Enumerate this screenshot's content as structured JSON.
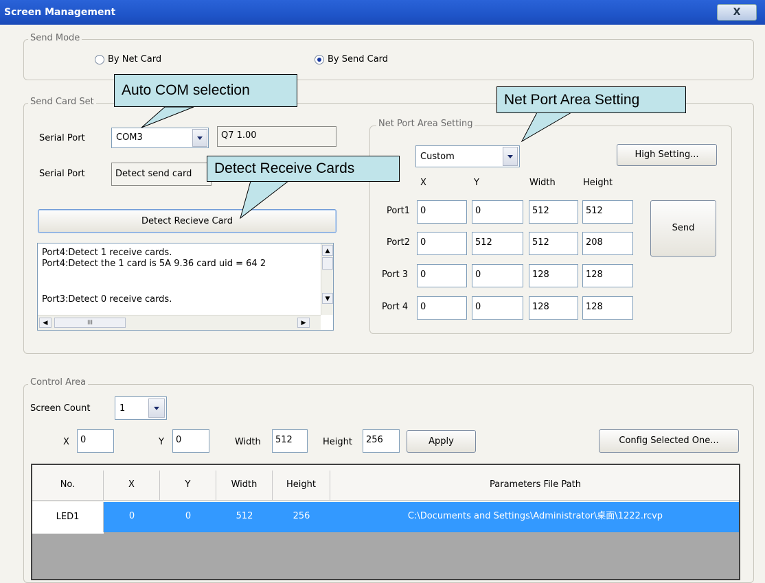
{
  "window": {
    "title": "Screen Management",
    "close_label": "X"
  },
  "send_mode": {
    "legend": "Send Mode",
    "options": [
      {
        "label": "By Net Card",
        "selected": false
      },
      {
        "label": "By Send Card",
        "selected": true
      }
    ]
  },
  "send_card_set": {
    "legend": "Send Card Set",
    "serial_port_label": "Serial Port",
    "serial_port_value": "COM3",
    "version": "Q7 1.00",
    "serial_port_label_2": "Serial Port",
    "detect_send_card": "Detect send card",
    "detect_button": "Detect Recieve Card",
    "log": [
      "Port4:Detect 1 receive cards.",
      "Port4:Detect the   1 card is 5A 9.36 card uid = 64 2",
      "",
      "Port3:Detect 0 receive cards."
    ],
    "hscroll_grip": "III"
  },
  "net_port_area": {
    "legend": "Net Port Area Setting",
    "mode": "Custom",
    "high_setting_button": "High Setting...",
    "send_button": "Send",
    "headers": [
      "X",
      "Y",
      "Width",
      "Height"
    ],
    "ports": [
      {
        "label": "Port1",
        "x": "0",
        "y": "0",
        "width": "512",
        "height": "512"
      },
      {
        "label": "Port2",
        "x": "0",
        "y": "512",
        "width": "512",
        "height": "208"
      },
      {
        "label": "Port 3",
        "x": "0",
        "y": "0",
        "width": "128",
        "height": "128"
      },
      {
        "label": "Port 4",
        "x": "0",
        "y": "0",
        "width": "128",
        "height": "128"
      }
    ]
  },
  "control_area": {
    "legend": "Control Area",
    "screen_count_label": "Screen Count",
    "screen_count": "1",
    "x_label": "X",
    "x": "0",
    "y_label": "Y",
    "y": "0",
    "width_label": "Width",
    "width": "512",
    "height_label": "Height",
    "height": "256",
    "apply_button": "Apply",
    "config_button": "Config Selected One...",
    "table": {
      "headers": [
        "No.",
        "X",
        "Y",
        "Width",
        "Height",
        "Parameters File Path"
      ],
      "rows": [
        {
          "no": "LED1",
          "x": "0",
          "y": "0",
          "width": "512",
          "height": "256",
          "path": "C:\\Documents and Settings\\Administrator\\桌面\\1222.rcvp"
        }
      ]
    }
  },
  "callouts": {
    "auto_com": "Auto COM selection",
    "detect_receive": "Detect Receive Cards",
    "net_port": "Net Port  Area Setting"
  },
  "colors": {
    "titlebar": "#2459d0",
    "selected_row": "#3399ff",
    "table_empty": "#a8a8a8",
    "callout": "#c0e4ea"
  }
}
